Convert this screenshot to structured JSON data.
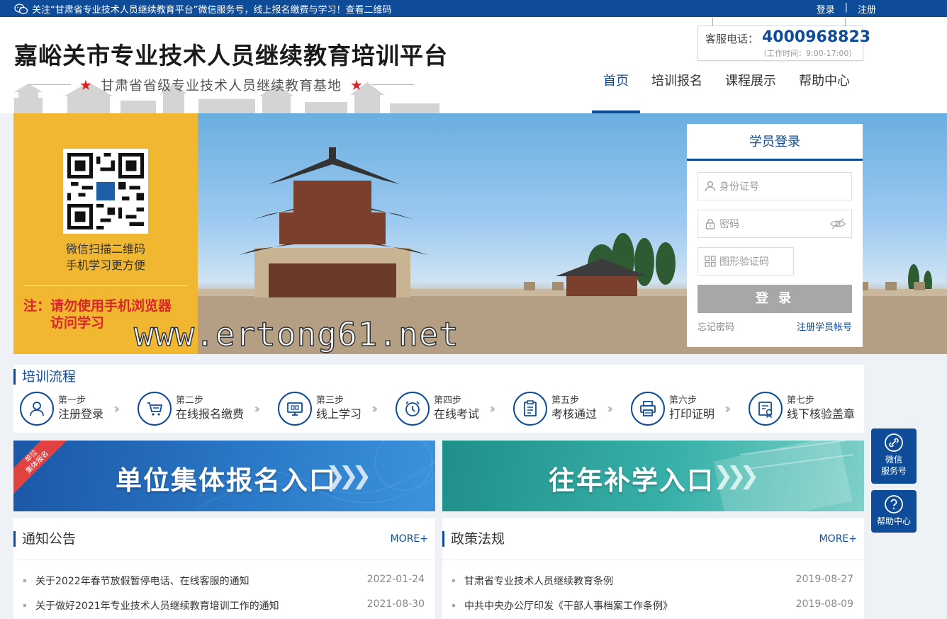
{
  "topbar": {
    "notice": "关注“甘肃省专业技术人员继续教育平台”微信服务号，线上报名缴费与学习！查看二维码",
    "login": "登录",
    "separator": "|",
    "register": "注册"
  },
  "header": {
    "title": "嘉峪关市专业技术人员继续教育培训平台",
    "subtitle": "甘肃省省级专业技术人员继续教育基地",
    "hotline_label": "客服电话：",
    "hotline_number": "4000968823",
    "hotline_hours": "（工作时间：9:00-17:00）"
  },
  "nav": {
    "items": [
      {
        "label": "首页",
        "active": true
      },
      {
        "label": "培训报名",
        "active": false
      },
      {
        "label": "课程展示",
        "active": false
      },
      {
        "label": "帮助中心",
        "active": false
      }
    ]
  },
  "banner": {
    "qr_caption_1": "微信扫描二维码",
    "qr_caption_2": "手机学习更方便",
    "warning_1": "注：请勿使用手机浏览器",
    "warning_2": "访问学习",
    "watermark": "www.ertong61.net"
  },
  "login": {
    "title": "学员登录",
    "id_placeholder": "身份证号",
    "password_placeholder": "密码",
    "captcha_placeholder": "图形验证码",
    "submit": "登 录",
    "forgot": "忘记密码",
    "register": "注册学员帐号"
  },
  "flow": {
    "title": "培训流程",
    "steps": [
      {
        "num": "第一步",
        "label": "注册登录",
        "icon": "user-icon"
      },
      {
        "num": "第二步",
        "label": "在线报名缴费",
        "icon": "cart-icon"
      },
      {
        "num": "第三步",
        "label": "线上学习",
        "icon": "monitor-icon"
      },
      {
        "num": "第四步",
        "label": "在线考试",
        "icon": "clock-icon"
      },
      {
        "num": "第五步",
        "label": "考核通过",
        "icon": "clipboard-icon"
      },
      {
        "num": "第六步",
        "label": "打印证明",
        "icon": "printer-icon"
      },
      {
        "num": "第七步",
        "label": "线下核验盖章",
        "icon": "certificate-icon"
      }
    ]
  },
  "cards": {
    "group": "单位集体报名入口",
    "group_ribbon_1": "单位",
    "group_ribbon_2": "集体报名",
    "makeup": "往年补学入口"
  },
  "notices": {
    "title": "通知公告",
    "more": "MORE+",
    "items": [
      {
        "text": "关于2022年春节放假暂停电话、在线客服的通知",
        "date": "2022-01-24"
      },
      {
        "text": "关于做好2021年专业技术人员继续教育培训工作的通知",
        "date": "2021-08-30"
      }
    ]
  },
  "policies": {
    "title": "政策法规",
    "more": "MORE+",
    "items": [
      {
        "text": "甘肃省专业技术人员继续教育条例",
        "date": "2019-08-27"
      },
      {
        "text": "中共中央办公厅印发《干部人事档案工作条例》",
        "date": "2019-08-09"
      }
    ]
  },
  "float": {
    "wechat_1": "微信",
    "wechat_2": "服务号",
    "help": "帮助中心"
  },
  "colors": {
    "brand_blue": "#0e4c9a",
    "qr_panel_yellow": "#f2b731",
    "warning_red": "#d8262b",
    "button_gray": "#a7a7a7"
  }
}
